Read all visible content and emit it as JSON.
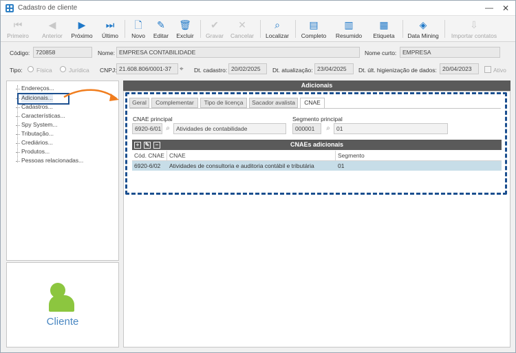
{
  "window": {
    "title": "Cadastro de cliente",
    "minimize": "—",
    "close": "✕"
  },
  "toolbar": {
    "buttons": [
      {
        "label": "Primeiro",
        "icon": "first-icon",
        "glyph": "⏮",
        "enabled": false
      },
      {
        "label": "Anterior",
        "icon": "previous-icon",
        "glyph": "◀",
        "enabled": false
      },
      {
        "label": "Próximo",
        "icon": "next-icon",
        "glyph": "▶",
        "enabled": true
      },
      {
        "label": "Último",
        "icon": "last-icon",
        "glyph": "⏭",
        "enabled": true
      },
      {
        "label": "Novo",
        "icon": "new-icon",
        "glyph": "🗋",
        "enabled": true
      },
      {
        "label": "Editar",
        "icon": "edit-icon",
        "glyph": "✎",
        "enabled": true
      },
      {
        "label": "Excluir",
        "icon": "delete-icon",
        "glyph": "🗑",
        "enabled": true
      },
      {
        "label": "Gravar",
        "icon": "save-icon",
        "glyph": "✔",
        "enabled": false
      },
      {
        "label": "Cancelar",
        "icon": "cancel-icon",
        "glyph": "✕",
        "enabled": false
      },
      {
        "label": "Localizar",
        "icon": "find-icon",
        "glyph": "⌕",
        "enabled": true
      },
      {
        "label": "Completo",
        "icon": "full-report-icon",
        "glyph": "▤",
        "enabled": true
      },
      {
        "label": "Resumido",
        "icon": "summary-report-icon",
        "glyph": "▥",
        "enabled": true
      },
      {
        "label": "Etiqueta",
        "icon": "label-print-icon",
        "glyph": "▦",
        "enabled": true
      },
      {
        "label": "Data Mining",
        "icon": "data-mining-icon",
        "glyph": "◈",
        "enabled": true
      },
      {
        "label": "Importar contatos",
        "icon": "import-contacts-icon",
        "glyph": "⇩",
        "enabled": false
      }
    ]
  },
  "form": {
    "codigo_label": "Código:",
    "codigo_value": "720858",
    "nome_label": "Nome:",
    "nome_value": "EMPRESA CONTABILIDADE",
    "nome_curto_label": "Nome curto:",
    "nome_curto_value": "EMPRESA",
    "tipo_label": "Tipo:",
    "tipo_fisica": "Física",
    "tipo_juridica": "Jurídica",
    "cnpj_label": "CNPJ:",
    "cnpj_value": "21.608.806/0001-37",
    "dt_cadastro_label": "Dt. cadastro:",
    "dt_cadastro_value": "20/02/2025",
    "dt_atualizacao_label": "Dt. atualização:",
    "dt_atualizacao_value": "23/04/2025",
    "dt_higienizacao_label": "Dt. últ. higienização de dados:",
    "dt_higienizacao_value": "20/04/2023",
    "ativo_label": "Ativo"
  },
  "tree": {
    "items": [
      "Endereços...",
      "Adicionais...",
      "Cadastros...",
      "Características...",
      "Spy System...",
      "Tributação...",
      "Crediários...",
      "Produtos...",
      "Pessoas relacionadas..."
    ],
    "selected_index": 1
  },
  "sidebar_card": {
    "label": "Cliente",
    "icon": "person-icon"
  },
  "panel": {
    "title": "Adicionais",
    "tabs": [
      "Geral",
      "Complementar",
      "Tipo de licença",
      "Sacador avalista",
      "CNAE"
    ],
    "active_tab": "CNAE"
  },
  "cnae": {
    "principal_label": "CNAE principal",
    "principal_code": "6920-6/01",
    "principal_desc": "Atividades de contabilidade",
    "segmento_label": "Segmento principal",
    "segmento_code": "000001",
    "segmento_desc": "01"
  },
  "grid": {
    "title": "CNAEs adicionais",
    "columns": [
      "Cód. CNAE",
      "CNAE",
      "Segmento"
    ],
    "rows": [
      {
        "cod": "6920-6/02",
        "cnae": "Atividades de consultoria e auditoria contábil e tributária",
        "segmento": "01"
      }
    ]
  },
  "colors": {
    "accent": "#1f78c8",
    "highlight_border": "#1b4f8f",
    "arrow": "#f07d1e",
    "person": "#8cc63f",
    "selected_row": "#c7dde8"
  }
}
